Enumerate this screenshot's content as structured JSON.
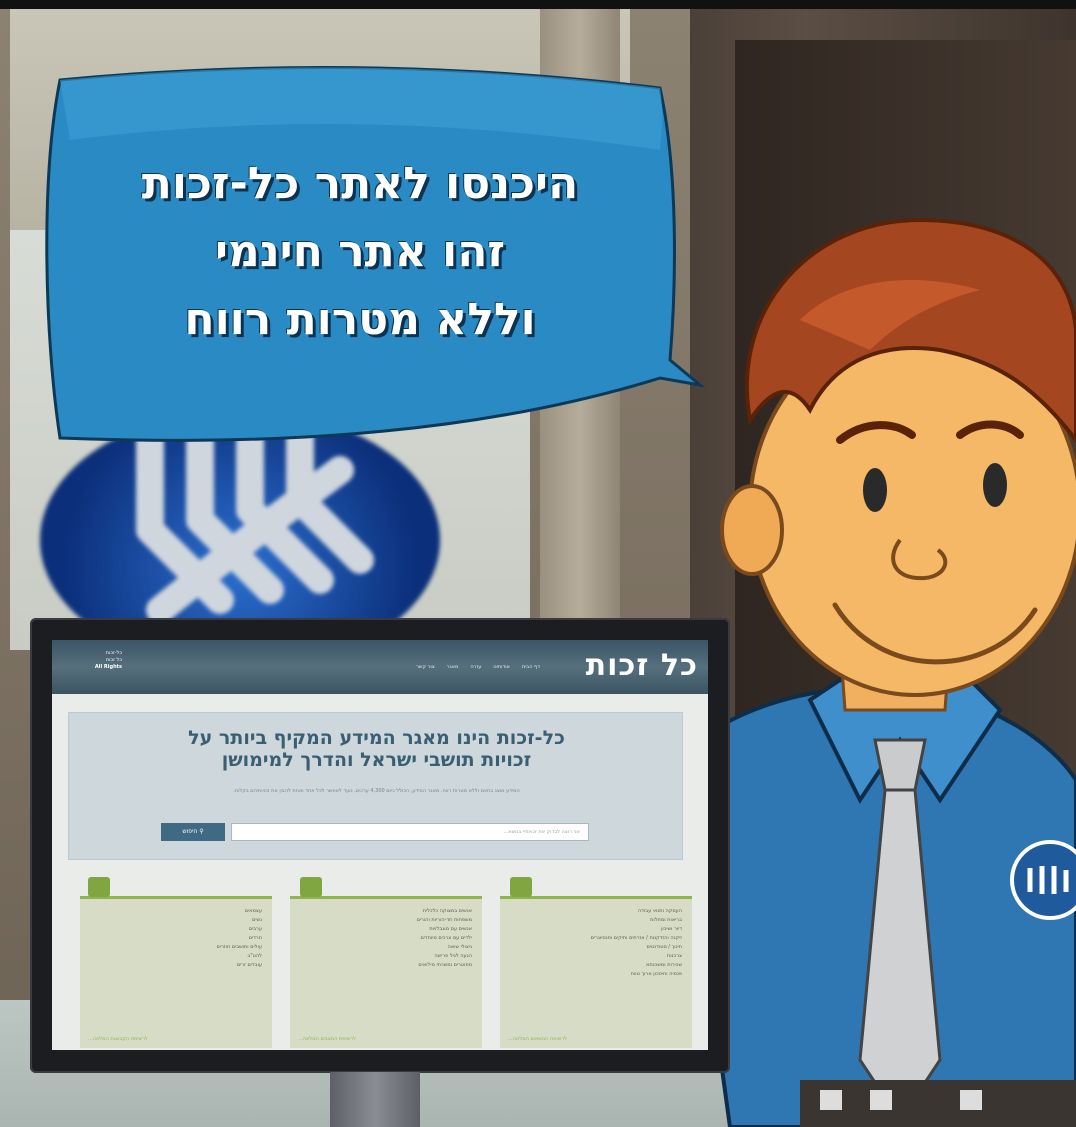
{
  "speech_bubble": {
    "line1": "היכנסו לאתר כל-זכות",
    "line2": "זהו אתר חינמי",
    "line3": "וללא מטרות רווח"
  },
  "website": {
    "logo": "כל זכות",
    "corner_line1": "כל-זכות",
    "corner_line2": "כל זכות",
    "corner_en": "All Rights",
    "nav": [
      "דף הבית",
      "אודותינו",
      "עזרה",
      "מאגר",
      "צור קשר"
    ],
    "hero_title_line1": "כל-זכות הינו מאגר המידע המקיף ביותר על",
    "hero_title_line2": "זכויות תושבי ישראל והדרך למימושן",
    "hero_sub": "המידע מוצג בחינם וללא מטרות רווח. מאגר המידע, הכולל כיום 4,300 ערכים, נועד לאפשר לכל אחד ואחת להבין את זכויותיהם בקלות.",
    "search_placeholder": "אני רוצה לבדוק את זכויותיי בנושא...",
    "search_button": "חיפוש",
    "cards": [
      {
        "items": [
          "העסקה ותנאי עבודה",
          "בריאות ומחלות",
          "דיור ושיכון",
          "זיקנה והזדקנות / אזרחים ותיקים ופנסיונרים",
          "חינוך / סטודנטים",
          "צרכנות",
          "שכירות ומשכנתא",
          "פנסיה וחיסכון ארוך טווח"
        ],
        "more": "לרשימת הנושאים המלאה..."
      },
      {
        "items": [
          "אנשים במצוקה כלכלית",
          "משפחות חד-הוריות והורים",
          "אנשים עם מוגבלויות",
          "ילדים עם צרכים מיוחדים",
          "ניצולי שואה",
          "הגעה לגיל פרישה",
          "מפוטרים ומשרתי מילואים"
        ],
        "more": "לרשימת המצבים המלאה..."
      },
      {
        "items": [
          "עצמאים",
          "נשים",
          "ערבים",
          "חרדים",
          "עולים ותושבים חוזרים",
          "להט\"ב",
          "עובדים זרים"
        ],
        "more": "לרשימת הקבוצות המלאה..."
      }
    ]
  },
  "colors": {
    "bubble_blue": "#1f7fb8",
    "site_header": "#3a5566",
    "site_accent_green": "#8fb54d",
    "shirt_blue": "#2f77b3"
  }
}
